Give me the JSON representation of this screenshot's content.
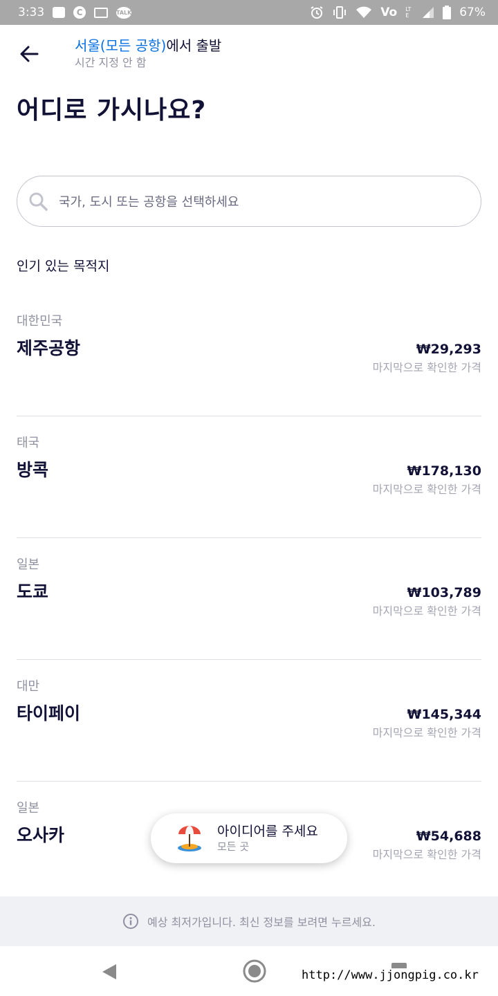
{
  "status_bar": {
    "time": "3:33",
    "volte": "Vo",
    "lte_label": "LTE",
    "battery": "67%",
    "left_icons": [
      "message-icon",
      "c-icon",
      "card-icon",
      "kakaotalk-icon"
    ],
    "right_icons": [
      "alarm-icon",
      "vibrate-icon",
      "wifi-icon",
      "signal-icon",
      "battery-icon"
    ],
    "c_icon_text": "C",
    "talk_icon_text": "TALK"
  },
  "header": {
    "origin_city": "서울(모든 공항)",
    "origin_suffix": "에서 출발",
    "date_text": "시간 지정 안 함"
  },
  "title": "어디로 가시나요?",
  "search": {
    "placeholder": "국가, 도시 또는 공항을 선택하세요"
  },
  "popular_label": "인기 있는 목적지",
  "destinations": [
    {
      "country": "대한민국",
      "city": "제주공항",
      "price": "₩29,293",
      "note": "마지막으로 확인한 가격"
    },
    {
      "country": "태국",
      "city": "방콕",
      "price": "₩178,130",
      "note": "마지막으로 확인한 가격"
    },
    {
      "country": "일본",
      "city": "도쿄",
      "price": "₩103,789",
      "note": "마지막으로 확인한 가격"
    },
    {
      "country": "대만",
      "city": "타이페이",
      "price": "₩145,344",
      "note": "마지막으로 확인한 가격"
    },
    {
      "country": "일본",
      "city": "오사카",
      "price": "₩54,688",
      "note": "마지막으로 확인한 가격"
    }
  ],
  "idea_button": {
    "title": "아이디어를 주세요",
    "subtitle": "모든 곳"
  },
  "info_bar": {
    "text": "예상 최저가입니다. 최신 정보를 보려면 누르세요."
  },
  "nav": {
    "watermark": "http://www.jjongpig.co.kr"
  },
  "colors": {
    "accent": "#0770e3",
    "text_primary": "#111236",
    "text_secondary": "#8f90a0",
    "status_bar_bg": "#a8a8a8",
    "info_bar_bg": "#eff1f5"
  }
}
